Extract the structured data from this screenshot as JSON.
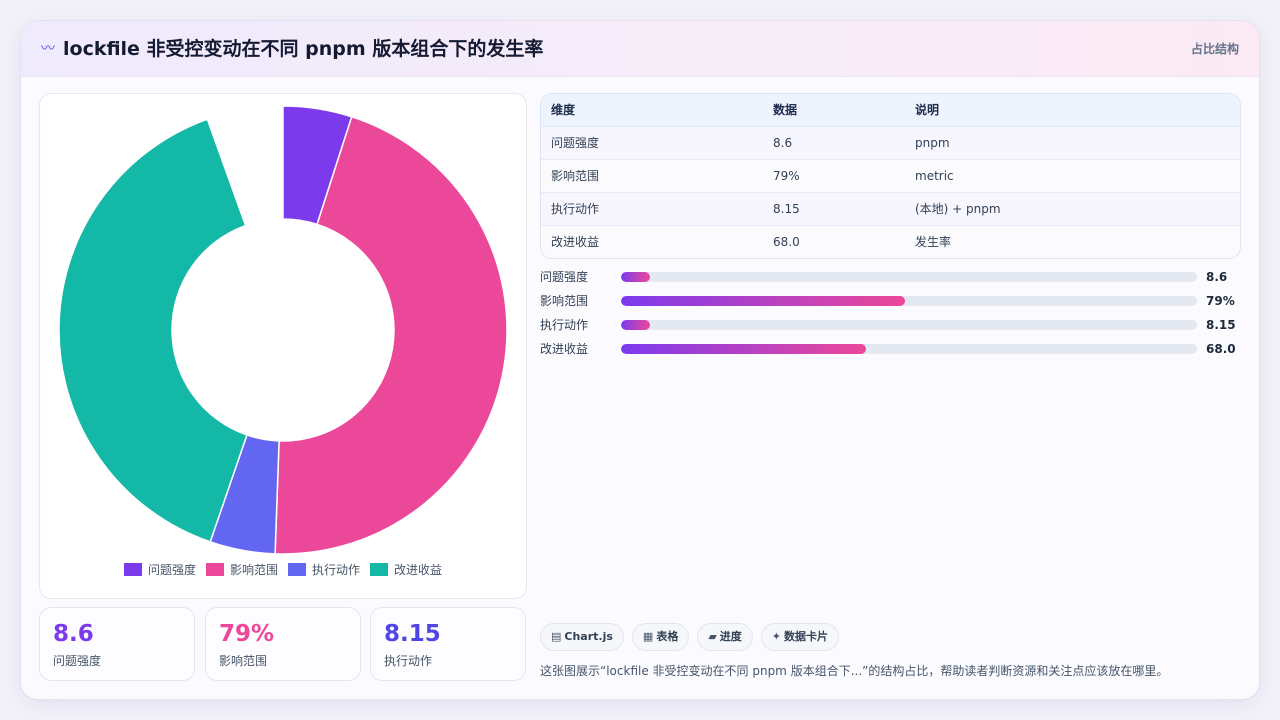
{
  "header": {
    "title_icon": "〰",
    "title": "lockfile 非受控变动在不同 pnpm 版本组合下的发生率",
    "right_label": "占比结构"
  },
  "colors": {
    "series": [
      "#7c3aed",
      "#ec4899",
      "#6366f1",
      "#14b8a6"
    ],
    "kpi": [
      "#7c3aed",
      "#ec4899",
      "#4f46e5"
    ]
  },
  "chart_data": {
    "type": "pie",
    "variant": "doughnut",
    "categories": [
      "问题强度",
      "影响范围",
      "执行动作",
      "改进收益"
    ],
    "values": [
      8.6,
      79,
      8.15,
      68.0
    ],
    "gap_value": 9.5,
    "legend_position": "bottom"
  },
  "kpis": [
    {
      "value": "8.6",
      "label": "问题强度"
    },
    {
      "value": "79%",
      "label": "影响范围"
    },
    {
      "value": "8.15",
      "label": "执行动作"
    }
  ],
  "table": {
    "headers": [
      "维度",
      "数据",
      "说明"
    ],
    "rows": [
      [
        "问题强度",
        "8.6",
        "pnpm"
      ],
      [
        "影响范围",
        "79%",
        "metric"
      ],
      [
        "执行动作",
        "8.15",
        "(本地) + pnpm"
      ],
      [
        "改进收益",
        "68.0",
        "发生率"
      ]
    ]
  },
  "progress": [
    {
      "label": "问题强度",
      "value": "8.6",
      "fraction": 0.05
    },
    {
      "label": "影响范围",
      "value": "79%",
      "fraction": 0.493
    },
    {
      "label": "执行动作",
      "value": "8.15",
      "fraction": 0.05
    },
    {
      "label": "改进收益",
      "value": "68.0",
      "fraction": 0.425
    }
  ],
  "tags": [
    {
      "icon": "▤",
      "label": "Chart.js"
    },
    {
      "icon": "▦",
      "label": "表格"
    },
    {
      "icon": "▰",
      "label": "进度"
    },
    {
      "icon": "✦",
      "label": "数据卡片"
    }
  ],
  "caption": "这张图展示“lockfile 非受控变动在不同 pnpm 版本组合下...”的结构占比，帮助读者判断资源和关注点应该放在哪里。"
}
